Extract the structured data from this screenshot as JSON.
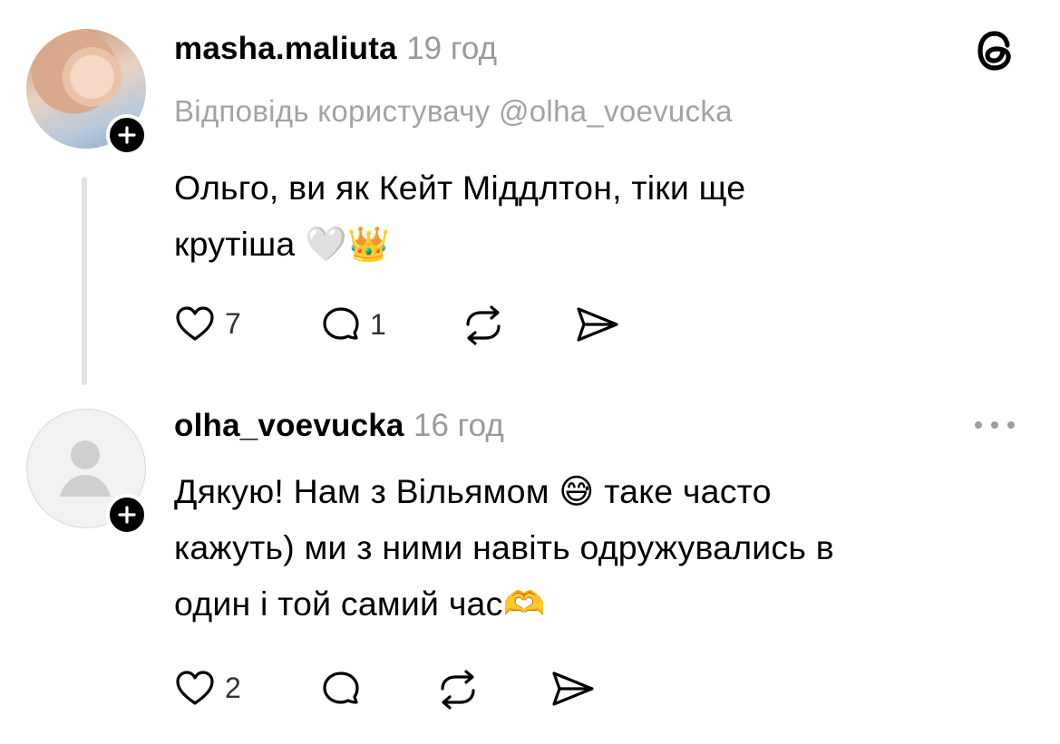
{
  "comments": [
    {
      "username": "masha.maliuta",
      "time": "19 год",
      "reply_to": "Відповідь користувачу @olha_voevucka",
      "text_line1": "Ольго, ви як Кейт Міддлтон, тіки ще",
      "text_line2": "крутіша 🤍👑",
      "likes": "7",
      "replies": "1"
    },
    {
      "username": "olha_voevucka",
      "time": "16 год",
      "text_line1": "Дякую! Нам з Вільямом 😅 таке часто",
      "text_line2": "кажуть) ми з ними навіть одружувались в",
      "text_line3": "один і той самий час🫶",
      "likes": "2"
    }
  ],
  "icons": {
    "app_logo": "threads-logo-icon",
    "more": "more-dots-icon",
    "like": "heart-icon",
    "reply": "comment-bubble-icon",
    "repost": "repost-icon",
    "share": "send-icon",
    "follow": "plus-icon"
  }
}
